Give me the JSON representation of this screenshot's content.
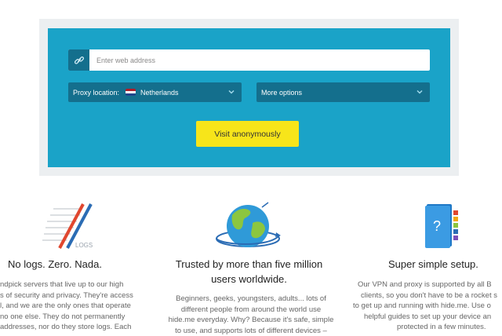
{
  "search": {
    "url_placeholder": "Enter web address",
    "location_label": "Proxy location:",
    "location_value": "Netherlands",
    "more_options_label": "More options",
    "submit_label": "Visit anonymously"
  },
  "features": [
    {
      "title": "No logs. Zero. Nada.",
      "icon": "no-logs-icon",
      "icon_text": "LOGS",
      "lines": [
        "ndpick servers that live up to our high",
        "s of security and privacy. They're access",
        "l, and we are the only ones that operate",
        "no one else. They do not permanently",
        "addresses, nor do they store logs. Each"
      ]
    },
    {
      "title_lines": [
        "Trusted by more than five million",
        "users worldwide."
      ],
      "icon": "globe-icon",
      "lines": [
        "Beginners, geeks, youngsters, adults... lots of",
        "different people from around the world use",
        "hide.me everyday. Why? Because it's safe, simple",
        "to use, and supports lots of different devices –"
      ]
    },
    {
      "title": "Super simple setup.",
      "icon": "setup-guide-icon",
      "lines": [
        "Our VPN and proxy is supported by all B",
        "clients, so you don't have to be a rocket s",
        "to get up and running with hide.me. Use o",
        "helpful guides to set up your device an",
        "protected in a few minutes."
      ]
    }
  ],
  "colors": {
    "panel": "#1aa3c8",
    "control_dark": "#146f8d",
    "button": "#f7e51a"
  }
}
